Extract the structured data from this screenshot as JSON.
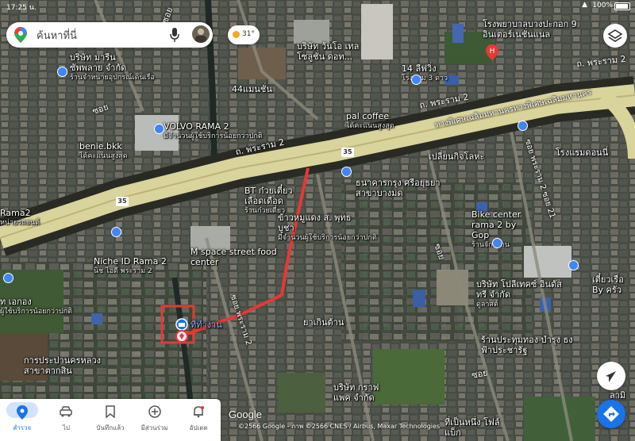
{
  "status_bar": {
    "time": "17:25 น.",
    "battery": "100%"
  },
  "search": {
    "placeholder": "ค้นหาที่นี่"
  },
  "weather": {
    "temp": "31°"
  },
  "roads": {
    "rama2_main": "ถ. พระราม 2",
    "rama2_north": "ถ. พระราม 2",
    "rama2_ne": "ถ. พระราม 2",
    "expressway": "ทางพิเศษเฉลิมมหานครทางพิเศษเฉลิมมหานคร",
    "soi_rama2_21": "ซอย พระราม 2 ซอย 21",
    "soi_rama2_vertical": "ซอย พระราม 2",
    "soi_left": "ซอย",
    "soi_middle": "ซอย",
    "soi_right": "ซอย",
    "soi_top": "ซอย",
    "hwy_35a": "35",
    "hwy_35b": "35"
  },
  "places": [
    {
      "name": "บริษัท มารีน ซัพพลาย จำกัด",
      "sub": "ร้านจำหน่ายอุปกรณ์เดินเรือ"
    },
    {
      "name": "VOLVO RAMA 2",
      "sub": "มีจำนวนผู้ใช้บริการน้อยกว่าปกติ"
    },
    {
      "name": "benie.bkk",
      "sub": "ได้คะแนนสูงสุด"
    },
    {
      "name": "44แมนชั่น",
      "sub": ""
    },
    {
      "name": "บริษัท วันโอ เทล โซลูชั่น ดอท...",
      "sub": ""
    },
    {
      "name": "14 ลีฟวิ่ง",
      "sub": "โรงแรม 3 ดาว"
    },
    {
      "name": "โรงพยาบาลบางปะกอก 9 อินเตอร์เนชั่นแนล",
      "sub": ""
    },
    {
      "name": "pal coffee",
      "sub": "ได้คะแนนสูงสุด"
    },
    {
      "name": "โรงแรมดอนนี่",
      "sub": ""
    },
    {
      "name": "เปลี่ยนกิจโลหะ",
      "sub": ""
    },
    {
      "name": "ธนาคารกรุง ศรีอยุธยา สาขาบางมด",
      "sub": ""
    },
    {
      "name": "BT ก๋วยเตี๋ยว เลือดเดือด",
      "sub": "ร้านก๋วยเตี๋ยว"
    },
    {
      "name": "ข้าวหมูแดง ส. พุทธบูชา",
      "sub": "มีจำนวนผู้ใช้บริการน้อยกว่าปกติ"
    },
    {
      "name": "Bike center rama 2 by Gop",
      "sub": "ร้านจักรยาน"
    },
    {
      "name": "Niche ID Rama 2",
      "sub": "นิช ไอดี พระราม 2"
    },
    {
      "name": "M space street food center",
      "sub": ""
    },
    {
      "name": "ที่ทำงาน",
      "sub": ""
    },
    {
      "name": "บริษัท โปลีเทคซ์ อินดัสทรี จำกัด",
      "sub": "ดูลาสต์"
    },
    {
      "name": "เตี๋ยวเรือ By ครัว",
      "sub": ""
    },
    {
      "name": "ท เอกอง",
      "sub": "ผู้ใช้บริการน้อยกว่าปกติ"
    },
    {
      "name": "ยาเกินต้าน",
      "sub": ""
    },
    {
      "name": "ร้านประทุมทอง บำรุง ธงฟ้าประชารัฐ",
      "sub": ""
    },
    {
      "name": "การประปานครหลวง สาขาตากสิน",
      "sub": ""
    },
    {
      "name": "บริษัท กราฟ แพค จำกัด",
      "sub": ""
    },
    {
      "name": "ที่เป็นหนึ่ง โฟล์แบ็ก",
      "sub": ""
    },
    {
      "name": "Rama2",
      "sub": "หน่ายรถยนต์"
    },
    {
      "name": "ลามิ",
      "sub": ""
    }
  ],
  "logo": "Google",
  "attribution": "©2566 Google - ภาพ ©2566 CNES / Airbus, Maxar Technologies",
  "nav": [
    {
      "label": "สำรวจ",
      "icon": "location-pin-icon"
    },
    {
      "label": "ไป",
      "icon": "car-icon"
    },
    {
      "label": "บันทึกแล้ว",
      "icon": "bookmark-icon"
    },
    {
      "label": "มีส่วนร่วม",
      "icon": "plus-circle-icon"
    },
    {
      "label": "อัปเดต",
      "icon": "bell-icon"
    }
  ],
  "colors": {
    "accent": "#1a73e8",
    "route": "#e53935",
    "road": "#d7cf9a"
  }
}
